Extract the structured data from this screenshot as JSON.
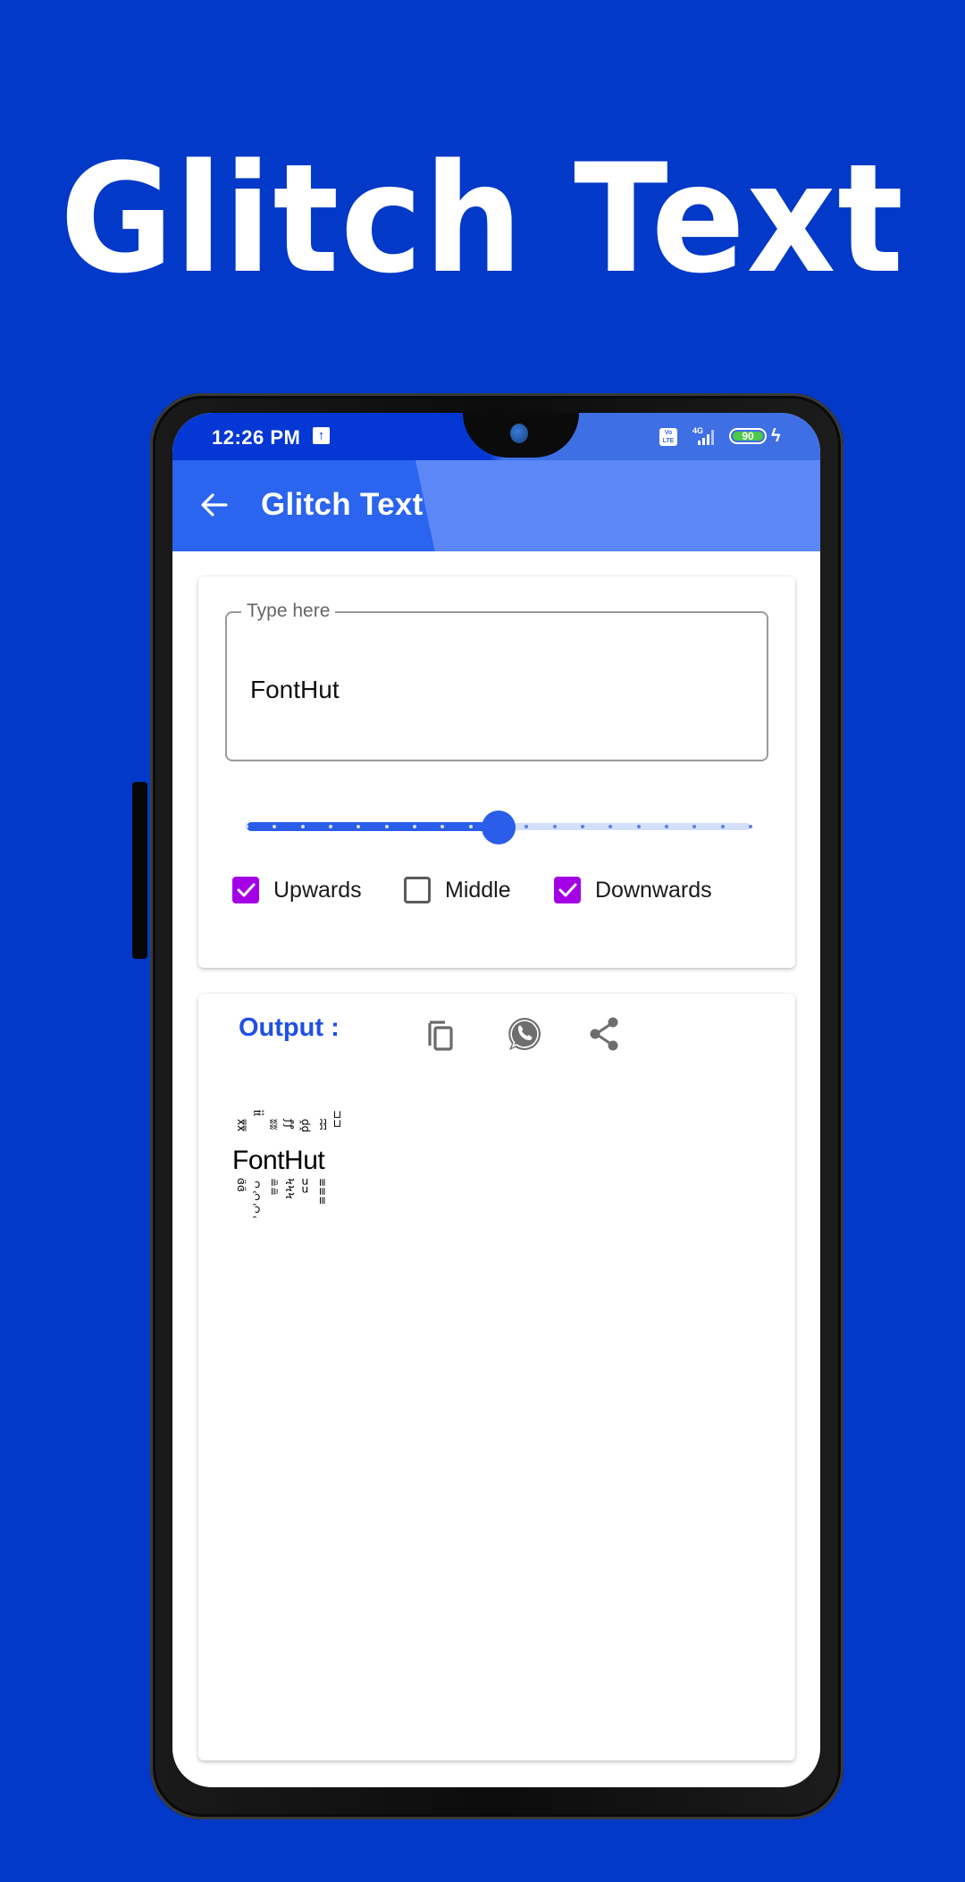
{
  "promo": {
    "headline": "Glitch Text"
  },
  "status_bar": {
    "time": "12:26 PM",
    "upload_icon": "upload-arrow-icon",
    "volte_label": "Vo LTE",
    "network_label": "4G",
    "battery_level": "90",
    "charging": true
  },
  "app_bar": {
    "back_icon": "arrow-left-icon",
    "title": "Glitch Text",
    "colors": {
      "primary": "#2a64ef",
      "shade": "#5c88f7"
    }
  },
  "input": {
    "legend": "Type here",
    "value": "FontHut"
  },
  "slider": {
    "value_fraction": 0.5,
    "steps": 18,
    "active_color": "#2a5eea",
    "inactive_color": "#d3dffc"
  },
  "options": [
    {
      "label": "Upwards",
      "checked": true
    },
    {
      "label": "Middle",
      "checked": false
    },
    {
      "label": "Downwards",
      "checked": true
    }
  ],
  "option_check_color": "#a400e6",
  "output": {
    "label": "Output :",
    "actions": [
      {
        "name": "copy",
        "icon": "copy-icon"
      },
      {
        "name": "whatsapp",
        "icon": "whatsapp-icon"
      },
      {
        "name": "share",
        "icon": "share-icon"
      }
    ],
    "glitch_text": "FontHut",
    "above_marks": [
      "x̿",
      "ṫ͛",
      "ʬ",
      "ꝭ",
      "ḓ",
      "ʭ",
      "⊐"
    ],
    "below_marks": [
      "ɞ̈",
      "ↄ̑",
      "≞",
      "Ϟ",
      "ᴝ",
      "≡"
    ]
  }
}
